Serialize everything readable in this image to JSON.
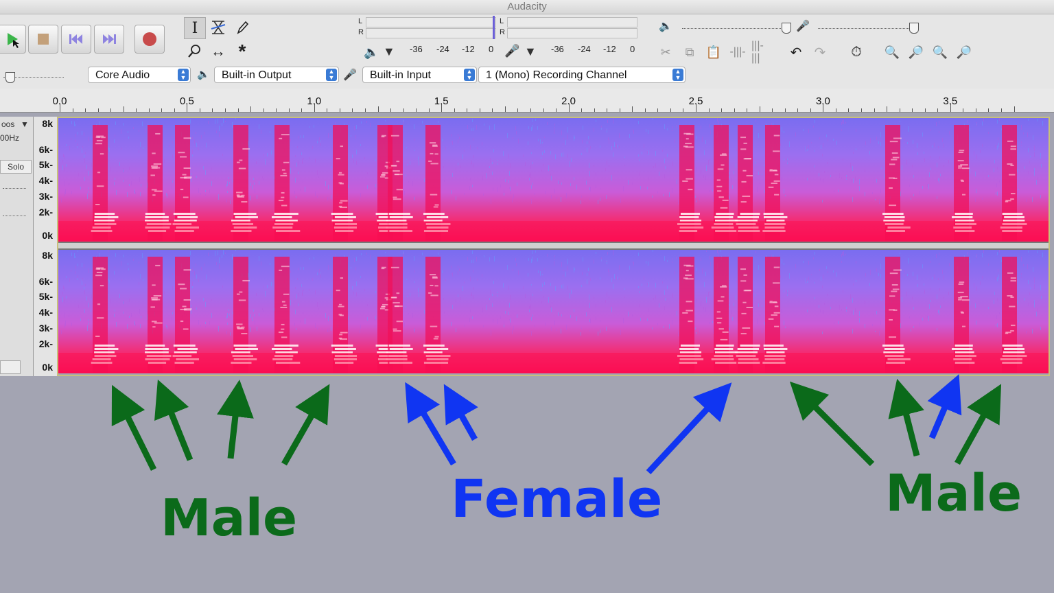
{
  "window": {
    "title": "Audacity"
  },
  "transport": {
    "play": "play-icon",
    "stop": "stop-icon",
    "skip_start": "skip-to-start-icon",
    "skip_end": "skip-to-end-icon",
    "record": "record-icon"
  },
  "meters": {
    "channel_l": "L",
    "channel_r": "R",
    "playback_scale": [
      "-36",
      "-24",
      "-12",
      "0"
    ],
    "record_scale": [
      "-36",
      "-24",
      "-12",
      "0"
    ]
  },
  "device_toolbar": {
    "host": "Core Audio",
    "output": "Built-in Output",
    "input": "Built-in Input",
    "channels": "1 (Mono) Recording Channel"
  },
  "ruler": {
    "labels": [
      "0.0",
      "0.5",
      "1.0",
      "1.5",
      "2.0",
      "2.5",
      "3.0",
      "3.5"
    ]
  },
  "track": {
    "name_fragment": "oos",
    "rate_fragment": "00Hz",
    "solo_label": "Solo"
  },
  "spectrogram": {
    "freq_labels": [
      "8k",
      "6k",
      "5k",
      "4k",
      "3k",
      "2k",
      "0k"
    ]
  },
  "annotations": {
    "male_left": "Male",
    "female_center": "Female",
    "male_right": "Male",
    "colors": {
      "male": "#0b6a1a",
      "female": "#1035f2"
    }
  }
}
